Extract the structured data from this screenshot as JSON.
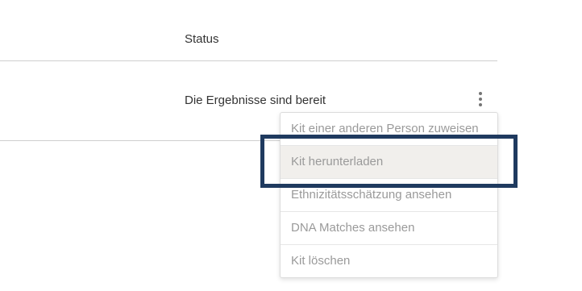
{
  "table": {
    "header": {
      "status": "Status"
    },
    "row": {
      "status": "Die Ergebnisse sind bereit"
    }
  },
  "menu": {
    "items": [
      {
        "label": "Kit einer anderen Person zuweisen"
      },
      {
        "label": "Kit herunterladen"
      },
      {
        "label": "Ethnizitätsschätzung ansehen"
      },
      {
        "label": "DNA Matches ansehen"
      },
      {
        "label": "Kit löschen"
      }
    ]
  },
  "colors": {
    "highlight": "#1f3a5f",
    "active_item_bg": "#f1efec"
  },
  "icons": {
    "row_actions": "kebab-menu-icon"
  }
}
